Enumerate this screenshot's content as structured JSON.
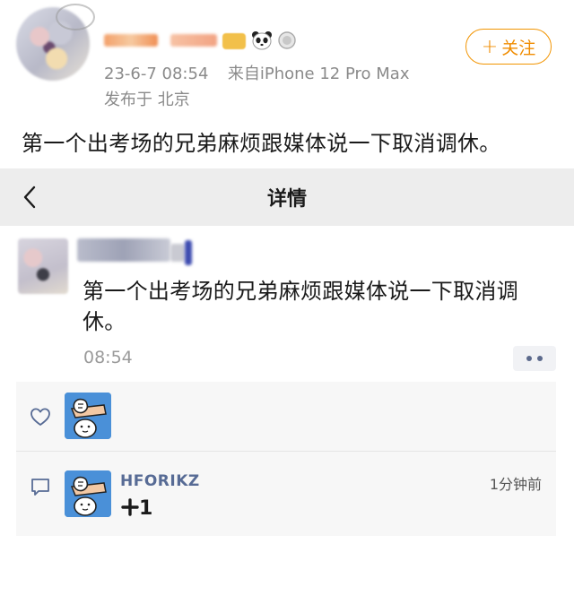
{
  "post": {
    "timestamp": "23-6-7 08:54",
    "source": "来自iPhone 12 Pro Max",
    "location": "发布于 北京",
    "follow_label": "关注",
    "body": "第一个出考场的兄弟麻烦跟媒体说一下取消调休。"
  },
  "nav": {
    "title": "详情"
  },
  "moment": {
    "text": "第一个出考场的兄弟麻烦跟媒体说一下取消调休。",
    "time": "08:54"
  },
  "comment": {
    "author": "HFORIKZ",
    "text": "1",
    "time": "1分钟前"
  },
  "colors": {
    "follow_accent": "#f29400",
    "link_blue": "#576b95",
    "avatar_blue": "#4a90d8",
    "nav_bg": "#ededed"
  },
  "icons": [
    "chevron-left-icon",
    "heart-icon",
    "comment-icon",
    "more-dots-icon",
    "plus-icon",
    "panda-icon",
    "medal-icon"
  ]
}
